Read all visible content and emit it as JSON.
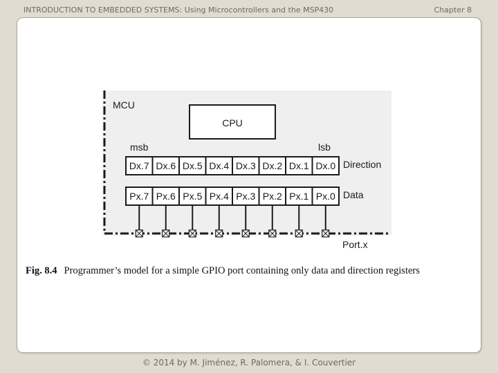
{
  "header": {
    "title": "INTRODUCTION TO EMBEDDED SYSTEMS: Using Microcontrollers and the MSP430",
    "chapter": "Chapter 8"
  },
  "figure": {
    "mcu_label": "MCU",
    "cpu_label": "CPU",
    "msb_label": "msb",
    "lsb_label": "lsb",
    "direction_label": "Direction",
    "data_label": "Data",
    "port_label": "Port.x",
    "direction_bits": [
      "Dx.7",
      "Dx.6",
      "Dx.5",
      "Dx.4",
      "Dx.3",
      "Dx.2",
      "Dx.1",
      "Dx.0"
    ],
    "data_bits": [
      "Px.7",
      "Px.6",
      "Px.5",
      "Px.4",
      "Px.3",
      "Px.2",
      "Px.1",
      "Px.0"
    ],
    "pin_icon": "x-box-pin-icon"
  },
  "caption": {
    "number": "Fig. 8.4",
    "text": "Programmer’s model for a simple GPIO port containing only data and direction registers"
  },
  "footer": {
    "copyright": "© 2014 by M. Jiménez, R. Palomera, & I. Couvertier"
  },
  "colors": {
    "page_bg": "#e1dcd1",
    "panel_bg": "#efefef",
    "ink": "#1a1a1a"
  }
}
